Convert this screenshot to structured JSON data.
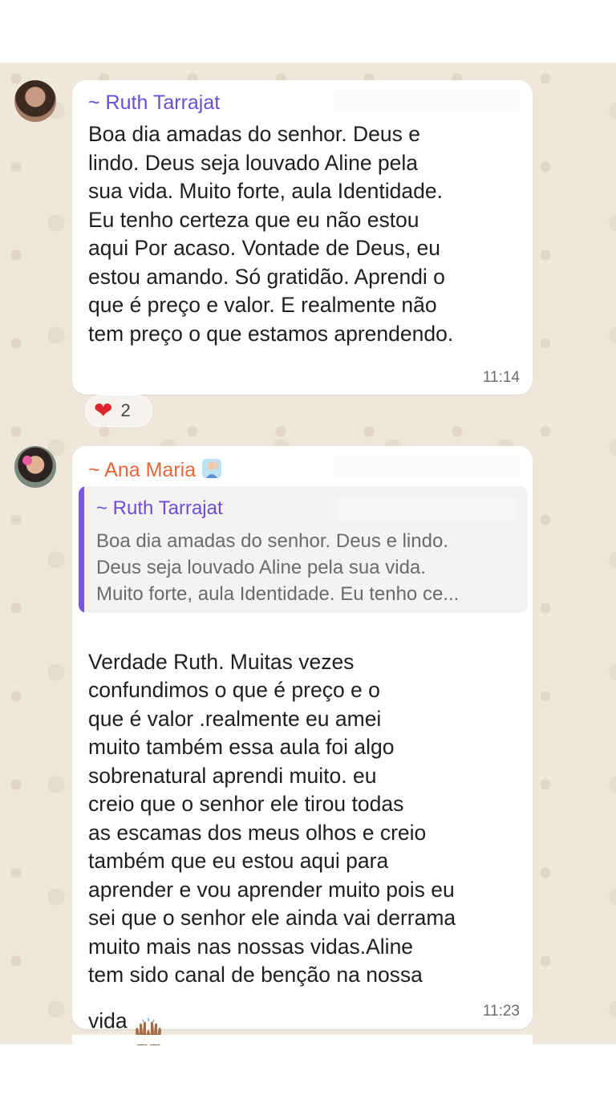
{
  "messages": [
    {
      "sender": "~ Ruth Tarrajat",
      "text": "Boa dia amadas do senhor. Deus e\nlindo. Deus seja louvado Aline pela\nsua vida. Muito forte, aula Identidade.\nEu tenho certeza que eu não estou\naqui Por acaso. Vontade de Deus, eu\nestou amando. Só gratidão. Aprendi o\nque é preço e valor. E realmente não\ntem preço o que estamos aprendendo.",
      "time": "11:14",
      "reaction": {
        "emoji": "heart-icon",
        "count": "2"
      }
    },
    {
      "sender": "~ Ana Maria",
      "sender_emoji": "person-raising-hand-icon",
      "quote": {
        "sender": "~ Ruth Tarrajat",
        "text": "Boa dia amadas do senhor. Deus e lindo.\nDeus seja louvado Aline pela sua vida.\nMuito forte, aula Identidade. Eu tenho ce..."
      },
      "text": "Verdade Ruth. Muitas vezes\nconfundimos o que é preço e o\nque é valor .realmente eu amei\nmuito também essa aula foi algo\nsobrenatural aprendi muito. eu\ncreio que o senhor ele tirou todas\nas escamas dos meus olhos e creio\ntambém que eu estou aqui para\naprender e vou aprender muito pois eu\nsei que o senhor ele ainda vai derrama\nmuito mais nas nossas vidas.Aline\ntem sido canal de benção na nossa\nvida",
      "text_trailing_emoji": "raising-hands-icon",
      "time": "11:23"
    }
  ],
  "colors": {
    "ruth_name": "#6a4fd6",
    "ana_name": "#e5663b",
    "quote_bar": "#7b55e2",
    "chat_background": "#efe7dc",
    "heart": "#e0242d"
  }
}
